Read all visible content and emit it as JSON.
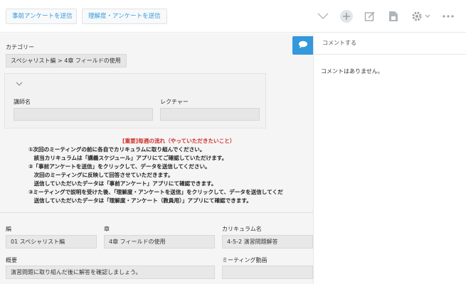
{
  "toolbar": {
    "pre_survey_button": "事前アンケートを送信",
    "comprehension_survey_button": "理解度・アンケートを送信",
    "icons": [
      "chevron-down-icon",
      "plus-icon",
      "edit-icon",
      "document-icon",
      "gear-icon",
      "more-icon"
    ]
  },
  "record": {
    "category_label": "カテゴリー",
    "category_value": "スペシャリスト編 > 4章 フィールドの使用",
    "lecturer_label": "講師名",
    "lecturer_value": "",
    "lecture_label": "レクチャー",
    "lecture_value": "",
    "volume_label": "編",
    "volume_value": "01 スペシャリスト編",
    "chapter_label": "章",
    "chapter_value": "4章 フィールドの使用",
    "curriculum_label": "カリキュラム名",
    "curriculum_value": "4-5-2 演習問題解答",
    "summary_label": "概要",
    "summary_value": "演習問題に取り組んだ後に解答を確認しましょう。",
    "meeting_video_label": "ミーティング動画",
    "meeting_video_value": ""
  },
  "notice": {
    "heading": "[重要]毎週の流れ（やっていただきたいこと）",
    "lines": [
      "①次回のミーティングの前に各自でカリキュラムに取り組んでください。",
      "　該当カリキュラムは「講義スケジュール」アプリにてご確認していただけます。",
      "②「事前アンケートを送信」をクリックして、データを送信してください。",
      "　次回のミーティングに反映して回答させていただきます。",
      "　送信していただいたデータは「事前アンケート」アプリにて確認できます。",
      "③ミーティングで説明を受けた後、「理解度・アンケートを送信」をクリックして、データを送信してくだ",
      "　送信していただいたデータは「理解度・アンケート（教員用）」アプリにて確認できます。"
    ]
  },
  "side": {
    "comment_placeholder": "コメントする",
    "no_comments": "コメントはありません。"
  },
  "colors": {
    "accent": "#3498db",
    "notice_heading": "#d0302a",
    "main_bg": "#f5f5f5"
  }
}
